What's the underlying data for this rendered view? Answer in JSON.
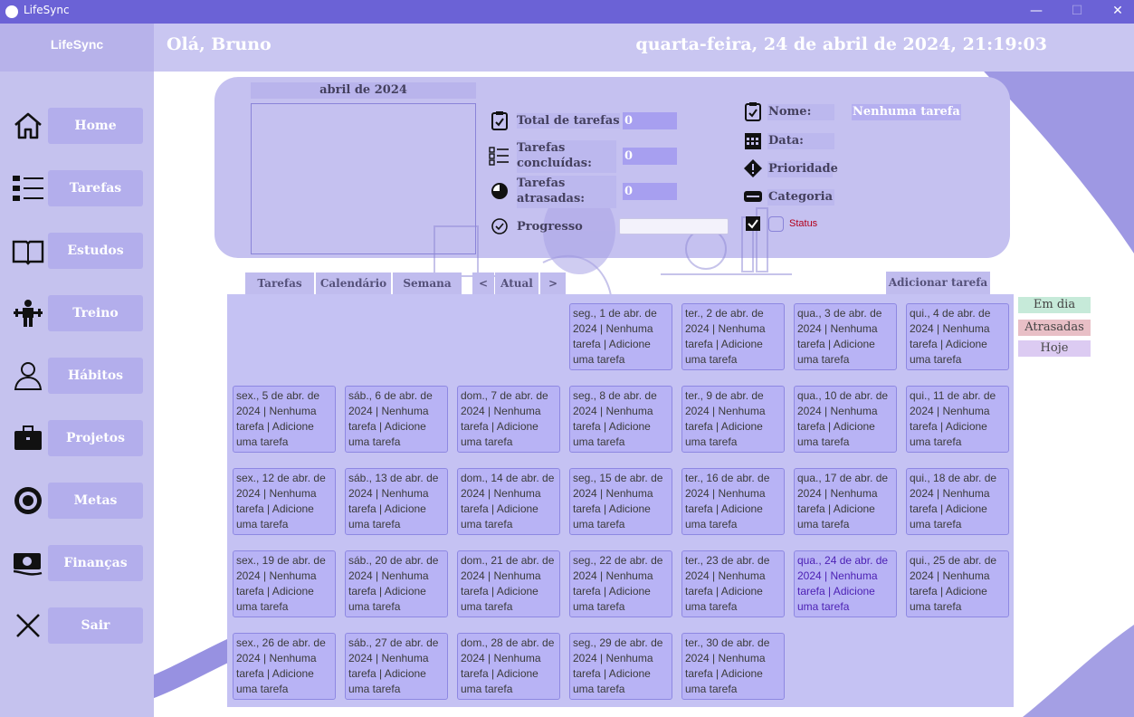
{
  "window": {
    "title": "LifeSync",
    "minimize": "—",
    "maximize": "☐",
    "close": "✕"
  },
  "sidebar": {
    "brand": "LifeSync",
    "items": [
      {
        "label": "Home",
        "icon": "home-icon"
      },
      {
        "label": "Tarefas",
        "icon": "checklist-icon"
      },
      {
        "label": "Estudos",
        "icon": "book-icon"
      },
      {
        "label": "Treino",
        "icon": "workout-icon"
      },
      {
        "label": "Hábitos",
        "icon": "person-icon"
      },
      {
        "label": "Projetos",
        "icon": "briefcase-icon"
      },
      {
        "label": "Metas",
        "icon": "target-icon"
      },
      {
        "label": "Finanças",
        "icon": "money-icon"
      },
      {
        "label": "Sair",
        "icon": "close-icon"
      }
    ]
  },
  "header": {
    "greeting": "Olá, Bruno",
    "datetime": "quarta-feira, 24 de abril de 2024, 21:19:03"
  },
  "calendar_widget": {
    "title": "abril de 2024"
  },
  "stats": {
    "total_label": "Total de tarefas",
    "total_value": "0",
    "done_label_1": "Tarefas",
    "done_label_2": "concluídas:",
    "done_value": "0",
    "late_label_1": "Tarefas",
    "late_label_2": "atrasadas:",
    "late_value": "0",
    "progress_label": "Progresso",
    "progress_fraction": 0
  },
  "task_info": {
    "name_label": "Nome:",
    "name_value": "Nenhuma tarefa",
    "date_label": "Data:",
    "priority_label": "Prioridade",
    "category_label": "Categoria",
    "status_label": "Status"
  },
  "tabs": {
    "tasks": "Tarefas",
    "calendar": "Calendário",
    "week": "Semana",
    "prev": "<",
    "current": "Atual",
    "next": ">"
  },
  "add_task": "Adicionar tarefa",
  "legend": [
    {
      "label": "Em dia",
      "color": "#c6ead9"
    },
    {
      "label": "Atrasadas",
      "color": "#e8bfc6"
    },
    {
      "label": "Hoje",
      "color": "#dccbf2"
    }
  ],
  "days": [
    "seg., 1 de abr. de 2024 | Nenhuma tarefa | Adicione uma tarefa",
    "ter., 2 de abr. de 2024 | Nenhuma tarefa | Adicione uma tarefa",
    "qua., 3 de abr. de 2024 | Nenhuma tarefa | Adicione uma tarefa",
    "qui., 4 de abr. de 2024 | Nenhuma tarefa | Adicione uma tarefa",
    "sex., 5 de abr. de 2024 | Nenhuma tarefa | Adicione uma tarefa",
    "sáb., 6 de abr. de 2024 | Nenhuma tarefa | Adicione uma tarefa",
    "dom., 7 de abr. de 2024 | Nenhuma tarefa | Adicione uma tarefa",
    "seg., 8 de abr. de 2024 | Nenhuma tarefa | Adicione uma tarefa",
    "ter., 9 de abr. de 2024 | Nenhuma tarefa | Adicione uma tarefa",
    "qua., 10 de abr. de 2024 | Nenhuma tarefa | Adicione uma tarefa",
    "qui., 11 de abr. de 2024 | Nenhuma tarefa | Adicione uma tarefa",
    "sex., 12 de abr. de 2024 | Nenhuma tarefa | Adicione uma tarefa",
    "sáb., 13 de abr. de 2024 | Nenhuma tarefa | Adicione uma tarefa",
    "dom., 14 de abr. de 2024 | Nenhuma tarefa | Adicione uma tarefa",
    "seg., 15 de abr. de 2024 | Nenhuma tarefa | Adicione uma tarefa",
    "ter., 16 de abr. de 2024 | Nenhuma tarefa | Adicione uma tarefa",
    "qua., 17 de abr. de 2024 | Nenhuma tarefa | Adicione uma tarefa",
    "qui., 18 de abr. de 2024 | Nenhuma tarefa | Adicione uma tarefa",
    "sex., 19 de abr. de 2024 | Nenhuma tarefa | Adicione uma tarefa",
    "sáb., 20 de abr. de 2024 | Nenhuma tarefa | Adicione uma tarefa",
    "dom., 21 de abr. de 2024 | Nenhuma tarefa | Adicione uma tarefa",
    "seg., 22 de abr. de 2024 | Nenhuma tarefa | Adicione uma tarefa",
    "ter., 23 de abr. de 2024 | Nenhuma tarefa | Adicione uma tarefa",
    "qua., 24 de abr. de 2024 | Nenhuma tarefa | Adicione uma tarefa",
    "qui., 25 de abr. de 2024 | Nenhuma tarefa | Adicione uma tarefa",
    "sex., 26 de abr. de 2024 | Nenhuma tarefa | Adicione uma tarefa",
    "sáb., 27 de abr. de 2024 | Nenhuma tarefa | Adicione uma tarefa",
    "dom., 28 de abr. de 2024 | Nenhuma tarefa | Adicione uma tarefa",
    "seg., 29 de abr. de 2024 | Nenhuma tarefa | Adicione uma tarefa",
    "ter., 30 de abr. de 2024 | Nenhuma tarefa | Adicione uma tarefa"
  ]
}
